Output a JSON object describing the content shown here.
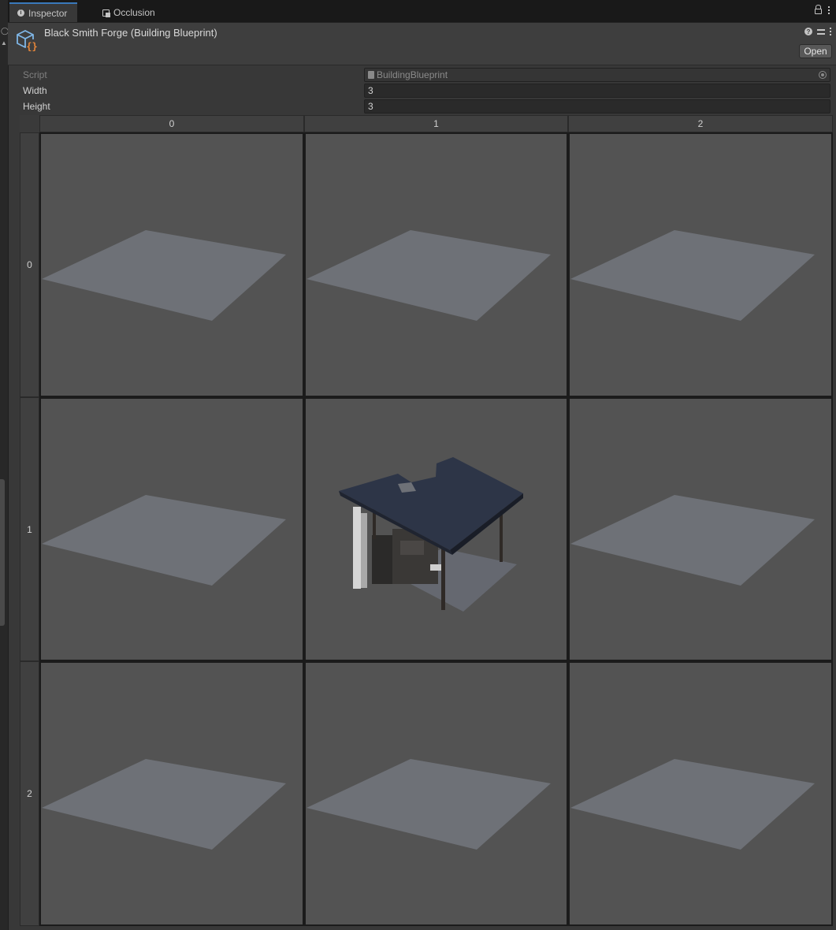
{
  "tabs": [
    {
      "label": "Inspector",
      "icon": "info-icon",
      "active": true
    },
    {
      "label": "Occlusion",
      "icon": "occlusion-icon",
      "active": false
    }
  ],
  "header": {
    "title": "Black Smith Forge (Building Blueprint)",
    "open_label": "Open",
    "help_glyph": "?"
  },
  "fields": {
    "script": {
      "label": "Script",
      "value": "BuildingBlueprint"
    },
    "width": {
      "label": "Width",
      "value": "3"
    },
    "height": {
      "label": "Height",
      "value": "3"
    }
  },
  "grid": {
    "columns": [
      "0",
      "1",
      "2"
    ],
    "rows": [
      "0",
      "1",
      "2"
    ],
    "cells": [
      [
        "empty-tile",
        "empty-tile",
        "empty-tile"
      ],
      [
        "empty-tile",
        "black-smith-forge",
        "empty-tile"
      ],
      [
        "empty-tile",
        "empty-tile",
        "empty-tile"
      ]
    ]
  },
  "colors": {
    "accent": "#3a79bb",
    "panel": "#383838",
    "cell": "#535353",
    "tile": "#6e7177",
    "asset_icon_orange": "#e8873a",
    "asset_icon_blue": "#7fb6e6"
  }
}
